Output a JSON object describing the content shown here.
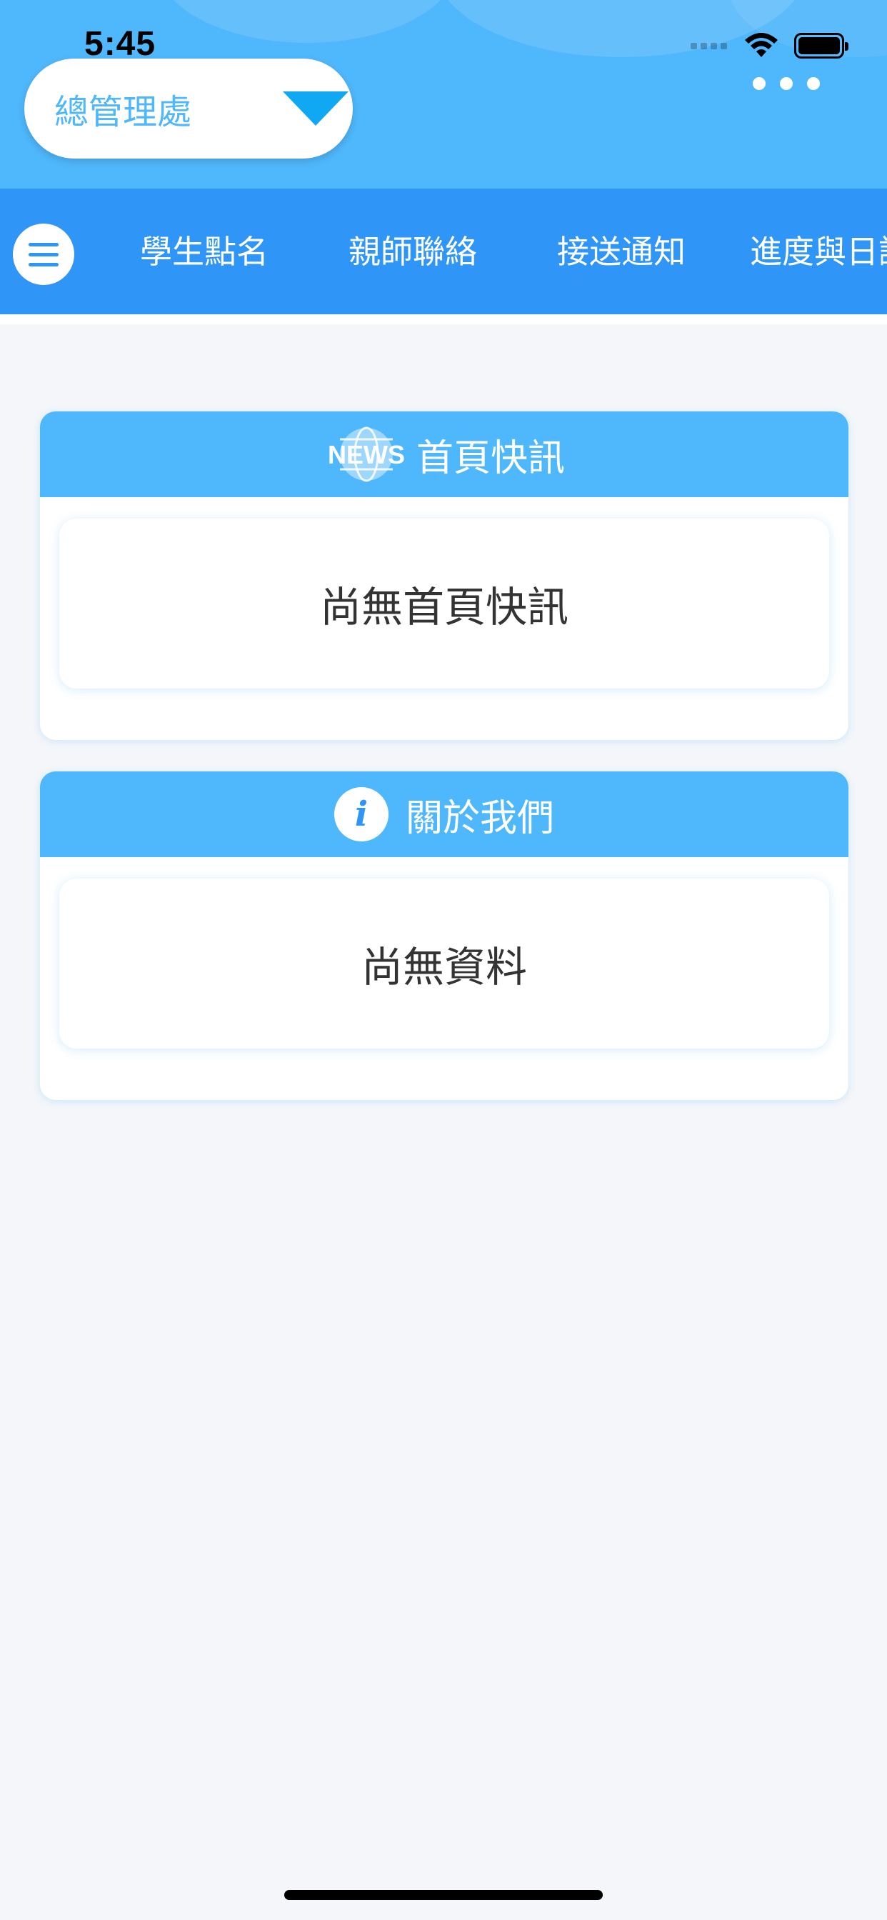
{
  "status_bar": {
    "time": "5:45"
  },
  "header": {
    "branch_select": {
      "value": "總管理處"
    }
  },
  "nav": {
    "tabs": [
      {
        "label": "學生點名"
      },
      {
        "label": "親師聯絡"
      },
      {
        "label": "接送通知"
      },
      {
        "label": "進度與日誌"
      }
    ]
  },
  "news_card": {
    "icon_text": "NEWS",
    "title": "首頁快訊",
    "empty_text": "尚無首頁快訊"
  },
  "about_card": {
    "icon_text": "i",
    "title": "關於我們",
    "empty_text": "尚無資料"
  },
  "colors": {
    "header_bg": "#4fb7fb",
    "navbar_bg": "#2f95f7",
    "dropdown_accent": "#11a8f3",
    "page_bg": "#f4f6f9"
  }
}
